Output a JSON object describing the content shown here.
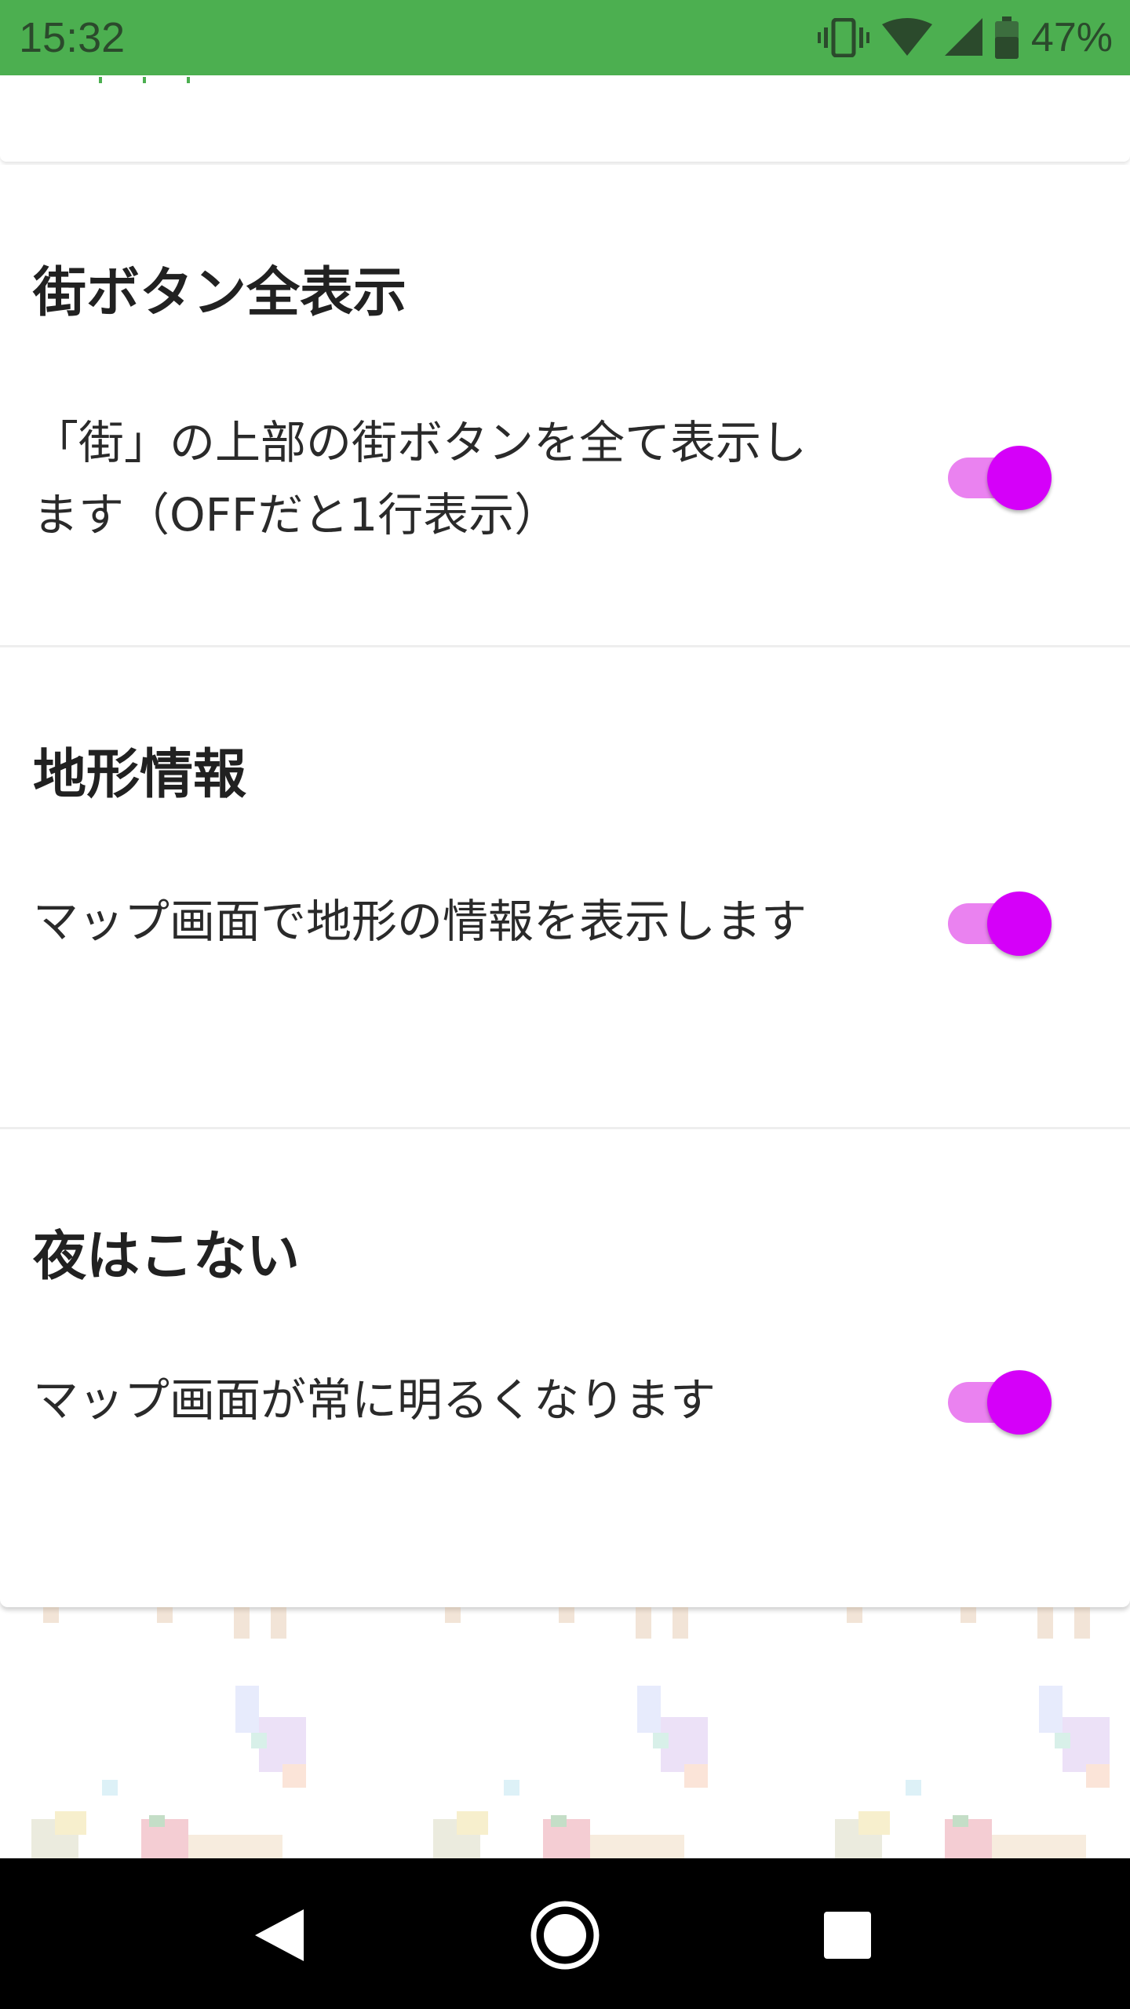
{
  "status_bar": {
    "time": "15:32",
    "battery_percent": "47%",
    "icons": [
      "vibrate-icon",
      "wifi-icon",
      "signal-icon",
      "battery-icon"
    ]
  },
  "settings": [
    {
      "title": "街ボタン全表示",
      "description_lines": [
        "「街」の上部の街ボタンを全て表示し",
        "ます（OFFだと1行表示）"
      ],
      "enabled": true
    },
    {
      "title": "地形情報",
      "description_lines": [
        "マップ画面で地形の情報を表示します"
      ],
      "enabled": true
    },
    {
      "title": "夜はこない",
      "description_lines": [
        "マップ画面が常に明るくなります"
      ],
      "enabled": true
    }
  ],
  "colors": {
    "status_bar": "#4caf50",
    "toggle_thumb": "#d500f9",
    "toggle_track": "#ea82f0"
  },
  "nav_bar": {
    "buttons": [
      "back-icon",
      "home-icon",
      "recents-icon"
    ]
  }
}
